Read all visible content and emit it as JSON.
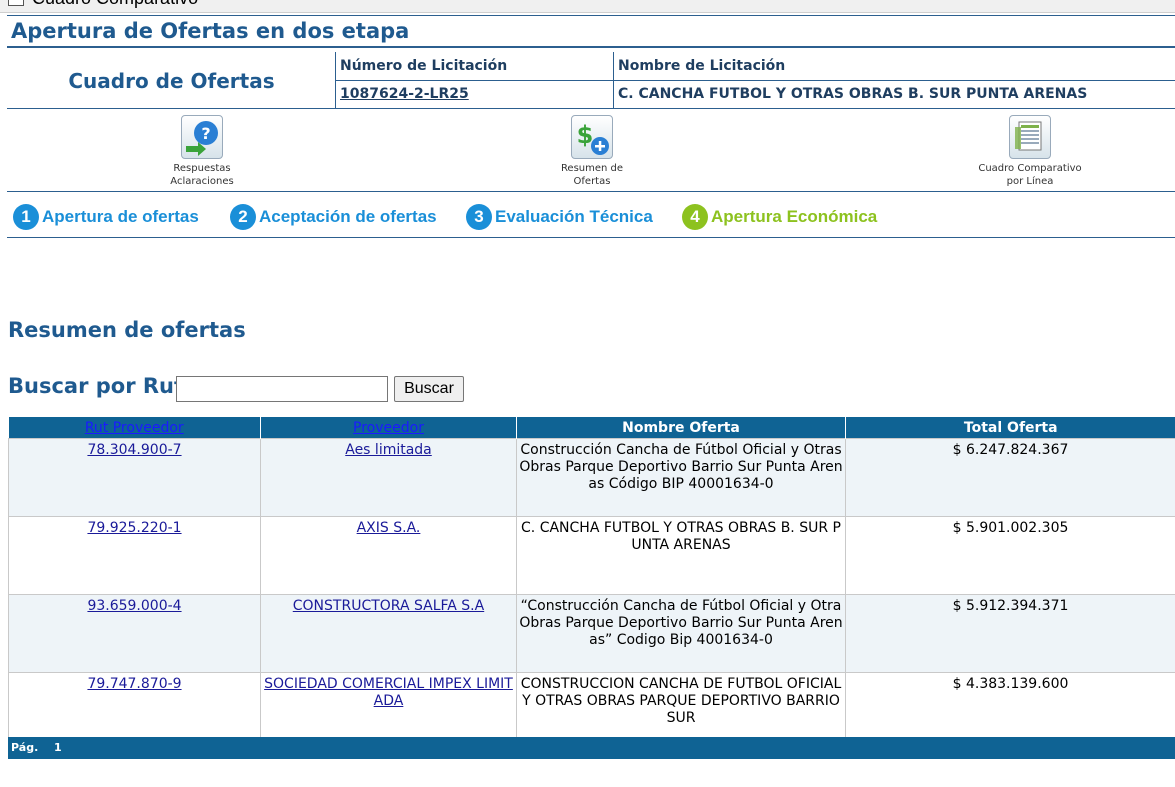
{
  "window": {
    "title": "Cuadro Comparativo"
  },
  "page": {
    "title": "Apertura de Ofertas en dos etapa"
  },
  "header": {
    "cuadro_title": "Cuadro de Ofertas",
    "numero_label": "Número de Licitación",
    "numero_value": "1087624-2-LR25",
    "nombre_label": "Nombre de Licitación",
    "nombre_value": "C. CANCHA FUTBOL Y OTRAS OBRAS B. SUR PUNTA ARENAS"
  },
  "toolbar": {
    "respuestas_line1": "Respuestas",
    "respuestas_line2": "Aclaraciones",
    "resumen_line1": "Resumen de",
    "resumen_line2": "Ofertas",
    "cuadro_line1": "Cuadro Comparativo",
    "cuadro_line2": "por Línea"
  },
  "steps": [
    {
      "num": "1",
      "label": "Apertura de ofertas",
      "color": "#1a8fd8"
    },
    {
      "num": "2",
      "label": "Aceptación de ofertas",
      "color": "#1a8fd8"
    },
    {
      "num": "3",
      "label": "Evaluación Técnica",
      "color": "#1a8fd8"
    },
    {
      "num": "4",
      "label": "Apertura Económica",
      "color": "#8dc21f"
    }
  ],
  "section": {
    "title": "Resumen de ofertas"
  },
  "search": {
    "label": "Buscar por Rut:",
    "value": "",
    "button": "Buscar"
  },
  "table": {
    "headers": {
      "rut": "Rut Proveedor",
      "proveedor": "Proveedor",
      "nombre": "Nombre Oferta",
      "total": "Total Oferta"
    },
    "rows": [
      {
        "rut": "78.304.900-7",
        "proveedor": "Aes limitada",
        "nombre": "Construcción Cancha de Fútbol Oficial y Otras Obras Parque Deportivo Barrio Sur Punta Arenas Código BIP 40001634-0",
        "total": "$ 6.247.824.367"
      },
      {
        "rut": "79.925.220-1",
        "proveedor": "AXIS S.A.",
        "nombre": "C. CANCHA FUTBOL Y OTRAS OBRAS B. SUR PUNTA ARENAS",
        "total": "$ 5.901.002.305"
      },
      {
        "rut": "93.659.000-4",
        "proveedor": "CONSTRUCTORA SALFA S.A",
        "nombre": "“Construcción Cancha de Fútbol Oficial y Otra Obras Parque Deportivo Barrio Sur Punta Arenas” Codigo Bip 4001634-0",
        "total": "$ 5.912.394.371"
      },
      {
        "rut": "79.747.870-9",
        "proveedor": "SOCIEDAD COMERCIAL IMPEX LIMITADA",
        "nombre": "CONSTRUCCION CANCHA DE FUTBOL OFICIAL Y OTRAS OBRAS PARQUE DEPORTIVO BARRIO SUR",
        "total": "$ 4.383.139.600"
      }
    ]
  },
  "footer": {
    "page_label": "Pág.",
    "page_number": "1"
  }
}
